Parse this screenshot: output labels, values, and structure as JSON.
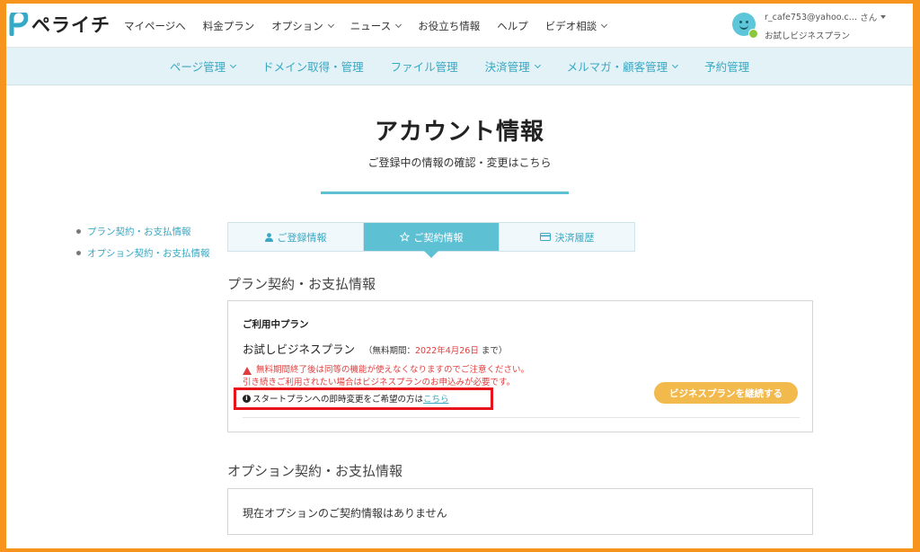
{
  "brand": {
    "name": "ペライチ",
    "color": "#36a9c6"
  },
  "topnav": {
    "items": [
      {
        "label": "マイページへ",
        "dropdown": false
      },
      {
        "label": "料金プラン",
        "dropdown": false
      },
      {
        "label": "オプション",
        "dropdown": true
      },
      {
        "label": "ニュース",
        "dropdown": true
      },
      {
        "label": "お役立ち情報",
        "dropdown": false
      },
      {
        "label": "ヘルプ",
        "dropdown": false
      },
      {
        "label": "ビデオ相談",
        "dropdown": true
      }
    ]
  },
  "user": {
    "email": "r_cafe753@yahoo.c…",
    "suffix": "さん",
    "plan": "お試しビジネスプラン"
  },
  "subnav": {
    "items": [
      {
        "label": "ページ管理",
        "dropdown": true
      },
      {
        "label": "ドメイン取得・管理",
        "dropdown": false
      },
      {
        "label": "ファイル管理",
        "dropdown": false
      },
      {
        "label": "決済管理",
        "dropdown": true
      },
      {
        "label": "メルマガ・顧客管理",
        "dropdown": true
      },
      {
        "label": "予約管理",
        "dropdown": false
      }
    ]
  },
  "header": {
    "title": "アカウント情報",
    "subtitle": "ご登録中の情報の確認・変更はこちら"
  },
  "side_links": [
    "プラン契約・お支払情報",
    "オプション契約・お支払情報"
  ],
  "tabs": [
    {
      "label": "ご登録情報",
      "icon": "user-icon",
      "active": false
    },
    {
      "label": "ご契約情報",
      "icon": "star-icon",
      "active": true
    },
    {
      "label": "決済履歴",
      "icon": "card-icon",
      "active": false
    }
  ],
  "plan_section": {
    "title": "プラン契約・お支払情報",
    "current_label": "ご利用中プラン",
    "plan_name": "お試しビジネスプラン",
    "period_prefix": "（無料期間：",
    "period_date": "2022年4月26日",
    "period_suffix": "まで）",
    "warning_line1": "無料期間終了後は同等の機能が使えなくなりますのでご注意ください。",
    "warning_line2": "引き続きご利用されたい場合はビジネスプランのお申込みが必要です。",
    "info_text": "スタートプランへの即時変更をご希望の方は",
    "info_link": "こちら",
    "continue_button": "ビジネスプランを継続する"
  },
  "option_section": {
    "title": "オプション契約・お支払情報",
    "empty_text": "現在オプションのご契約情報はありません"
  },
  "colors": {
    "accent": "#5ec0d3",
    "link": "#3aa8c3",
    "warning": "#e03e3e",
    "button": "#f2b94c",
    "frame": "#f7941d",
    "highlight": "#e8141c"
  }
}
